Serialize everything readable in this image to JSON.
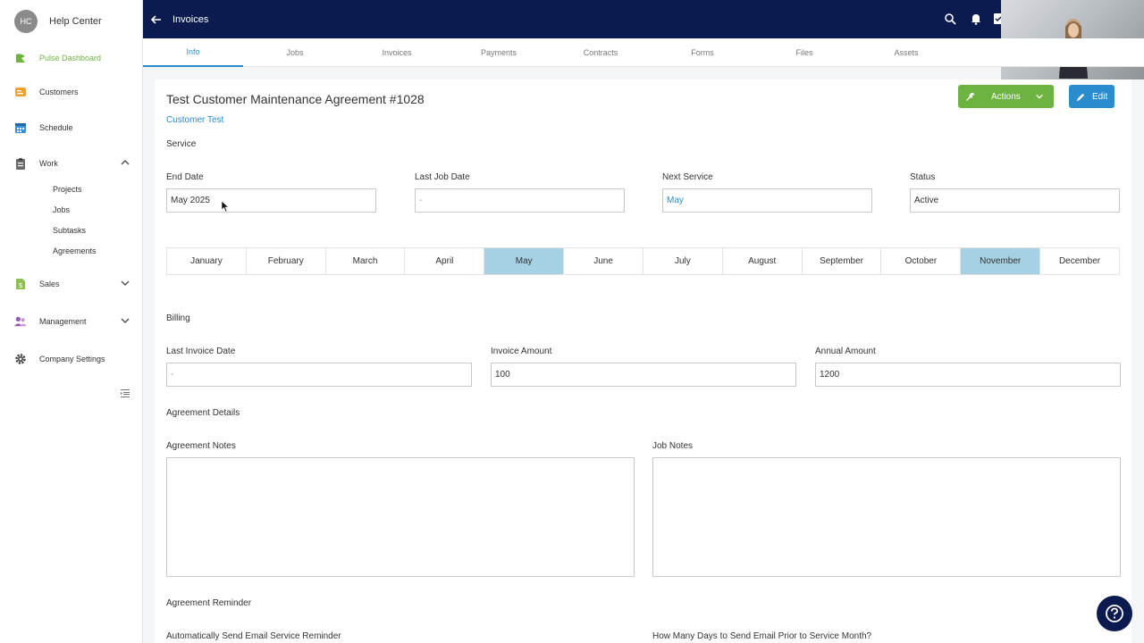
{
  "brand": {
    "initials": "HC",
    "name": "Help Center"
  },
  "sidebar": {
    "items": [
      {
        "label": "Pulse Dashboard",
        "icon": "pulse-icon"
      },
      {
        "label": "Customers",
        "icon": "customers-icon"
      },
      {
        "label": "Schedule",
        "icon": "calendar-icon"
      },
      {
        "label": "Work",
        "icon": "clipboard-icon"
      },
      {
        "label": "Sales",
        "icon": "dollar-doc-icon"
      },
      {
        "label": "Management",
        "icon": "people-icon"
      },
      {
        "label": "Company Settings",
        "icon": "gear-icon"
      }
    ],
    "work_sub": [
      "Projects",
      "Jobs",
      "Subtasks",
      "Agreements"
    ]
  },
  "topbar": {
    "title": "Invoices"
  },
  "tabs": [
    "Info",
    "Jobs",
    "Invoices",
    "Payments",
    "Contracts",
    "Forms",
    "Files",
    "Assets"
  ],
  "agreement": {
    "title": "Test Customer Maintenance Agreement #1028",
    "customer": "Customer Test",
    "service_heading": "Service",
    "actions_label": "Actions",
    "edit_label": "Edit"
  },
  "service": {
    "end_date_label": "End Date",
    "end_date": "May 2025",
    "last_job_label": "Last Job Date",
    "last_job": "-",
    "next_service_label": "Next Service",
    "next_service": "May",
    "status_label": "Status",
    "status": "Active"
  },
  "months": [
    "January",
    "February",
    "March",
    "April",
    "May",
    "June",
    "July",
    "August",
    "September",
    "October",
    "November",
    "December"
  ],
  "selected_months": [
    "May",
    "November"
  ],
  "billing": {
    "heading": "Billing",
    "last_invoice_label": "Last Invoice Date",
    "last_invoice": "-",
    "invoice_amount_label": "Invoice Amount",
    "invoice_amount": "100",
    "annual_amount_label": "Annual Amount",
    "annual_amount": "1200"
  },
  "details": {
    "heading": "Agreement Details",
    "notes_label": "Agreement Notes",
    "job_notes_label": "Job Notes"
  },
  "reminder": {
    "heading": "Agreement Reminder",
    "auto_email_label": "Automatically Send Email Service Reminder",
    "days_prior_label": "How Many Days to Send Email Prior to Service Month?"
  },
  "colors": {
    "navy": "#0b1a4f",
    "green": "#6db33f",
    "blue": "#2b8ccd",
    "selected_month": "#a6d0e4"
  }
}
